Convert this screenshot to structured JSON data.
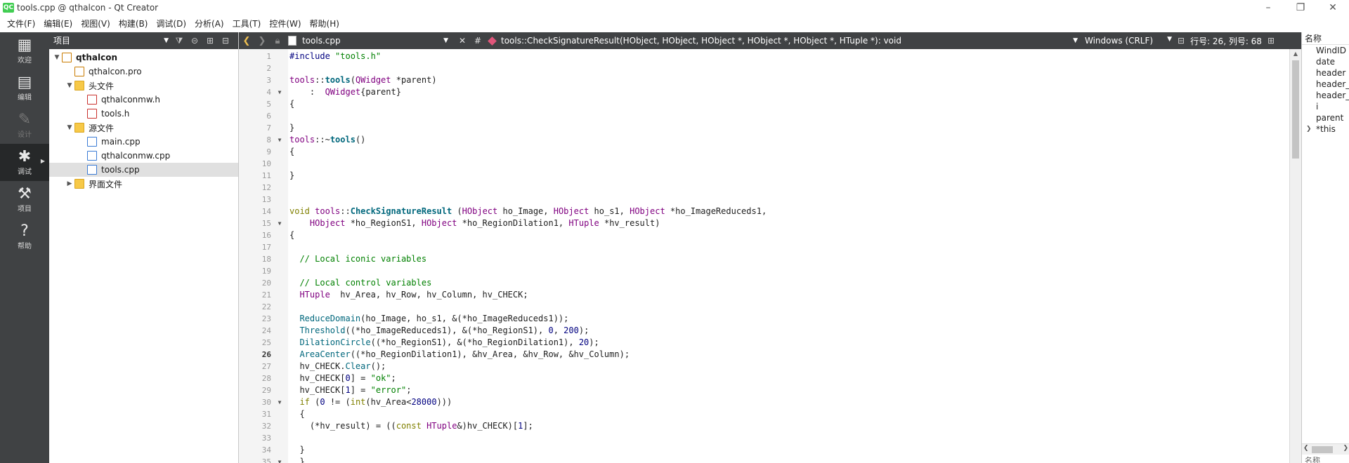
{
  "window": {
    "title": "tools.cpp @ qthalcon - Qt Creator",
    "logo": "QC",
    "buttons": [
      "minimize-icon",
      "maximize-icon",
      "close-icon"
    ]
  },
  "menu": [
    "文件(F)",
    "编辑(E)",
    "视图(V)",
    "构建(B)",
    "调试(D)",
    "分析(A)",
    "工具(T)",
    "控件(W)",
    "帮助(H)"
  ],
  "modes": [
    {
      "label": "欢迎",
      "icon": "grid-icon",
      "glyph": "▦"
    },
    {
      "label": "编辑",
      "icon": "document-icon",
      "glyph": "▤"
    },
    {
      "label": "设计",
      "icon": "pencil-icon",
      "glyph": "✎"
    },
    {
      "label": "调试",
      "icon": "bug-icon",
      "glyph": "✱"
    },
    {
      "label": "项目",
      "icon": "wrench-icon",
      "glyph": "⚒"
    },
    {
      "label": "帮助",
      "icon": "help-icon",
      "glyph": "?"
    }
  ],
  "project_pane": {
    "selector": "项目",
    "tree": [
      {
        "label": "qthalcon",
        "depth": 0,
        "expander": "▼",
        "icon": "proj",
        "bold": true
      },
      {
        "label": "qthalcon.pro",
        "depth": 1,
        "expander": "",
        "icon": "proj"
      },
      {
        "label": "头文件",
        "depth": 1,
        "expander": "▼",
        "icon": "folder"
      },
      {
        "label": "qthalconmw.h",
        "depth": 2,
        "expander": "",
        "icon": "hdr"
      },
      {
        "label": "tools.h",
        "depth": 2,
        "expander": "",
        "icon": "hdr"
      },
      {
        "label": "源文件",
        "depth": 1,
        "expander": "▼",
        "icon": "folder"
      },
      {
        "label": "main.cpp",
        "depth": 2,
        "expander": "",
        "icon": "src"
      },
      {
        "label": "qthalconmw.cpp",
        "depth": 2,
        "expander": "",
        "icon": "src"
      },
      {
        "label": "tools.cpp",
        "depth": 2,
        "expander": "",
        "icon": "src",
        "selected": true
      },
      {
        "label": "界面文件",
        "depth": 1,
        "expander": "▶",
        "icon": "folder"
      }
    ]
  },
  "editor_toolbar": {
    "file": "tools.cpp",
    "hash": "#",
    "symbol": "tools::CheckSignatureResult(HObject, HObject, HObject *, HObject *, HObject *, HTuple *): void",
    "line_ending": "Windows (CRLF)",
    "position": "行号: 26, 列号: 68"
  },
  "editor": {
    "current_line": 26,
    "lines": [
      {
        "n": 1,
        "fold": "",
        "html": "<span class=\"pp\">#include</span> <span class=\"str\">\"tools.h\"</span>"
      },
      {
        "n": 2,
        "fold": "",
        "html": ""
      },
      {
        "n": 3,
        "fold": "",
        "html": "<span class=\"ty\">tools</span>::<span class=\"fnb\">tools</span>(<span class=\"ty\">QWidget</span> *parent)"
      },
      {
        "n": 4,
        "fold": "▼",
        "html": "    :  <span class=\"ty\">QWidget</span>{parent}"
      },
      {
        "n": 5,
        "fold": "",
        "html": "{"
      },
      {
        "n": 6,
        "fold": "",
        "html": ""
      },
      {
        "n": 7,
        "fold": "",
        "html": "}"
      },
      {
        "n": 8,
        "fold": "▼",
        "html": "<span class=\"ty\">tools</span>::~<span class=\"fnb\">tools</span>()"
      },
      {
        "n": 9,
        "fold": "",
        "html": "{"
      },
      {
        "n": 10,
        "fold": "",
        "html": ""
      },
      {
        "n": 11,
        "fold": "",
        "html": "}"
      },
      {
        "n": 12,
        "fold": "",
        "html": ""
      },
      {
        "n": 13,
        "fold": "",
        "html": ""
      },
      {
        "n": 14,
        "fold": "",
        "html": "<span class=\"kw\">void</span> <span class=\"ty\">tools</span>::<span class=\"fnb\">CheckSignatureResult</span> (<span class=\"ty\">HObject</span> ho_Image, <span class=\"ty\">HObject</span> ho_s1, <span class=\"ty\">HObject</span> *ho_ImageReduceds1,"
      },
      {
        "n": 15,
        "fold": "▼",
        "html": "    <span class=\"ty\">HObject</span> *ho_RegionS1, <span class=\"ty\">HObject</span> *ho_RegionDilation1, <span class=\"ty\">HTuple</span> *hv_result)"
      },
      {
        "n": 16,
        "fold": "",
        "html": "{"
      },
      {
        "n": 17,
        "fold": "",
        "html": ""
      },
      {
        "n": 18,
        "fold": "",
        "html": "  <span class=\"cm\">// Local iconic variables</span>"
      },
      {
        "n": 19,
        "fold": "",
        "html": ""
      },
      {
        "n": 20,
        "fold": "",
        "html": "  <span class=\"cm\">// Local control variables</span>"
      },
      {
        "n": 21,
        "fold": "",
        "html": "  <span class=\"ty\">HTuple</span>  hv_Area, hv_Row, hv_Column, hv_CHECK;"
      },
      {
        "n": 22,
        "fold": "",
        "html": ""
      },
      {
        "n": 23,
        "fold": "",
        "html": "  <span class=\"fn\">ReduceDomain</span>(ho_Image, ho_s1, &amp;(*ho_ImageReduceds1));"
      },
      {
        "n": 24,
        "fold": "",
        "html": "  <span class=\"fn\">Threshold</span>((*ho_ImageReduceds1), &amp;(*ho_RegionS1), <span class=\"num\">0</span>, <span class=\"num\">200</span>);"
      },
      {
        "n": 25,
        "fold": "",
        "html": "  <span class=\"fn\">DilationCircle</span>((*ho_RegionS1), &amp;(*ho_RegionDilation1), <span class=\"num\">20</span>);"
      },
      {
        "n": 26,
        "fold": "",
        "html": "  <span class=\"fn\">AreaCenter</span>((*ho_RegionDilation1), &amp;hv_Area, &amp;hv_Row, &amp;hv_Column);"
      },
      {
        "n": 27,
        "fold": "",
        "html": "  hv_CHECK.<span class=\"fn\">Clear</span>();"
      },
      {
        "n": 28,
        "fold": "",
        "html": "  hv_CHECK[<span class=\"num\">0</span>] = <span class=\"str\">\"ok\"</span>;"
      },
      {
        "n": 29,
        "fold": "",
        "html": "  hv_CHECK[<span class=\"num\">1</span>] = <span class=\"str\">\"error\"</span>;"
      },
      {
        "n": 30,
        "fold": "▼",
        "html": "  <span class=\"kw\">if</span> (<span class=\"num\">0</span> != (<span class=\"kw\">int</span>(hv_Area&lt;<span class=\"num\">28000</span>)))"
      },
      {
        "n": 31,
        "fold": "",
        "html": "  {"
      },
      {
        "n": 32,
        "fold": "",
        "html": "    (*hv_result) = ((<span class=\"kw\">const</span> <span class=\"ty\">HTuple</span>&amp;)hv_CHECK)[<span class=\"num\">1</span>];"
      },
      {
        "n": 33,
        "fold": "",
        "html": ""
      },
      {
        "n": 34,
        "fold": "",
        "html": "  }"
      },
      {
        "n": 35,
        "fold": "▼",
        "html": "  }"
      }
    ]
  },
  "right_pane": {
    "header": "名称",
    "rows": [
      {
        "label": "WindID",
        "expandable": false
      },
      {
        "label": "date",
        "expandable": false
      },
      {
        "label": "header",
        "expandable": false
      },
      {
        "label": "header_",
        "expandable": false
      },
      {
        "label": "header_",
        "expandable": false
      },
      {
        "label": "i",
        "expandable": false
      },
      {
        "label": "parent",
        "expandable": false
      },
      {
        "label": "*this",
        "expandable": true
      }
    ],
    "footer": "名称"
  },
  "colors": {
    "modebar_bg": "#404244",
    "toolbar_bg": "#404244",
    "selected_row": "#e0e0e0",
    "type_color": "#800080",
    "function_color": "#00677c",
    "string_color": "#008000",
    "keyword_color": "#808000"
  }
}
